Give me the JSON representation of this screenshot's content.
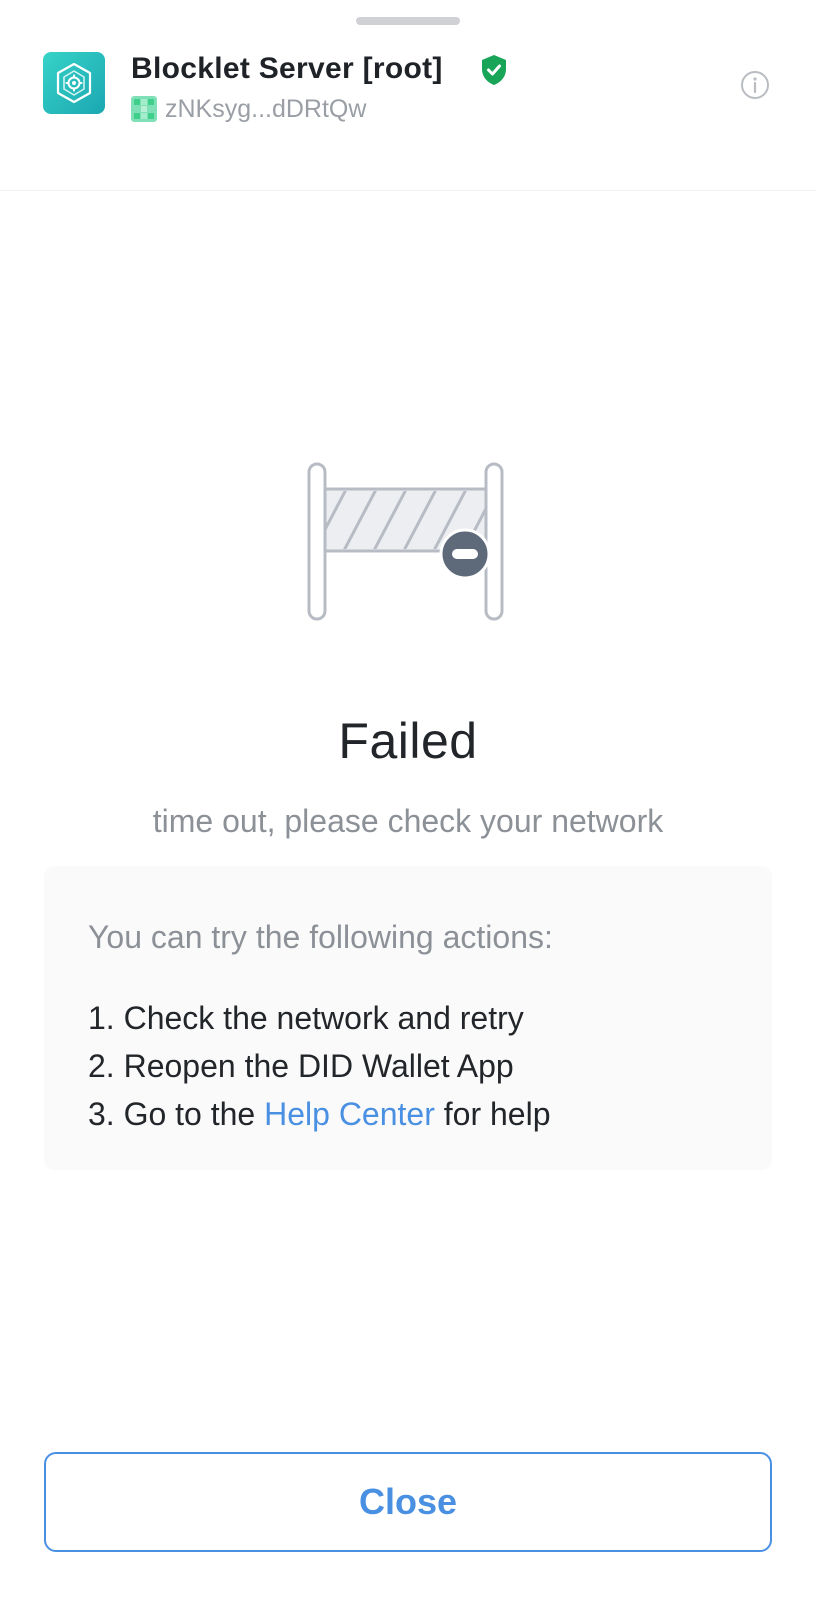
{
  "header": {
    "app_title": "Blocklet Server [root]",
    "did_short": "zNKsyg...dDRtQw",
    "icons": {
      "logo": "blocklet-server-logo",
      "verified": "verified-shield-icon",
      "info": "info-icon",
      "did_avatar": "did-avatar-icon"
    }
  },
  "status": {
    "illustration": "road-barrier-icon",
    "title": "Failed",
    "message": "time out, please check your network"
  },
  "tips": {
    "heading": "You can try the following actions:",
    "step1": "1. Check the network and retry",
    "step2": "2. Reopen the DID Wallet App",
    "step3_prefix": "3. Go to the ",
    "step3_link": "Help Center",
    "step3_suffix": " for help"
  },
  "actions": {
    "close_label": "Close"
  },
  "colors": {
    "accent": "#4a90e2",
    "verified_green": "#18a558",
    "logo_teal": "#26bcbe",
    "title_text": "#222529",
    "muted_text": "#8c9097",
    "tips_background": "#fafafa"
  }
}
